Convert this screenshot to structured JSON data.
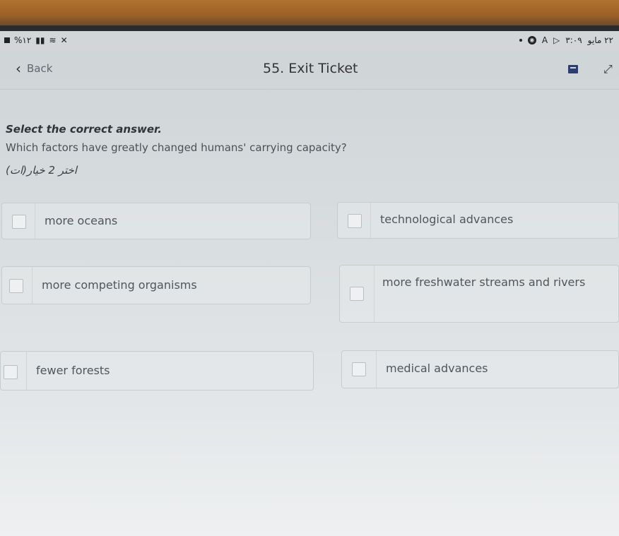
{
  "status": {
    "left": "%١٢",
    "right_time": "٣:٠٩",
    "right_date": "٢٢ مايو"
  },
  "header": {
    "back_label": "Back",
    "title": "55. Exit Ticket"
  },
  "prompt": "Select the correct answer.",
  "question": "Which factors have greatly changed humans' carrying capacity?",
  "instruction_ar": "اختر 2 خيار(ات)",
  "options": [
    {
      "label": "more oceans"
    },
    {
      "label": "technological advances"
    },
    {
      "label": "more competing organisms"
    },
    {
      "label": "more freshwater streams and rivers"
    },
    {
      "label": "fewer forests"
    },
    {
      "label": "medical advances"
    }
  ]
}
